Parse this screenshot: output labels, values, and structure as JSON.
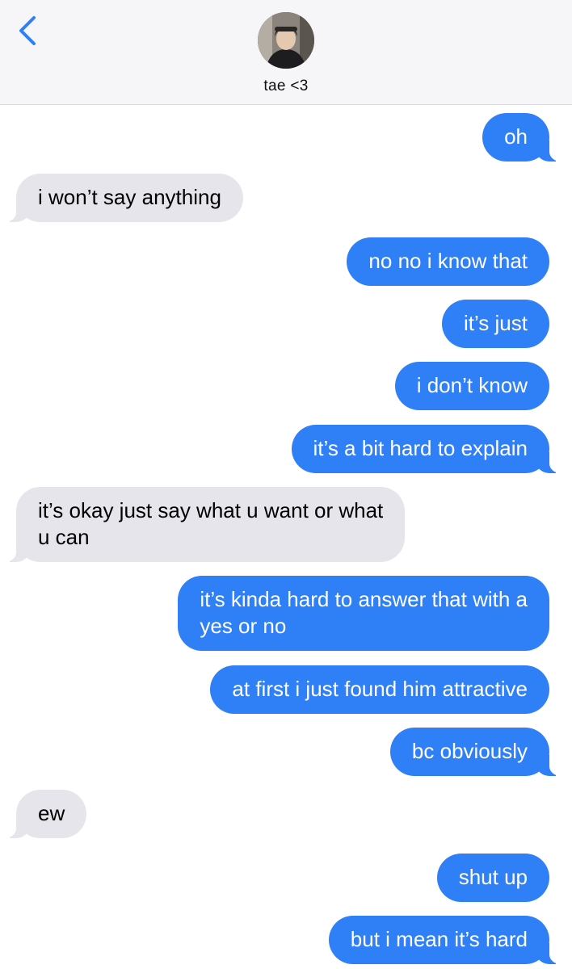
{
  "header": {
    "contact_name": "tae <3",
    "back_icon": "chevron-left-icon",
    "avatar": "contact-photo"
  },
  "colors": {
    "sent_bubble": "#2f7ff6",
    "received_bubble": "#e6e5eb",
    "back_accent": "#2f7ff6"
  },
  "messages": [
    {
      "from": "me",
      "text": "oh"
    },
    {
      "from": "them",
      "text": "i won’t say anything"
    },
    {
      "from": "me",
      "text": "no no i know that"
    },
    {
      "from": "me",
      "text": "it’s just"
    },
    {
      "from": "me",
      "text": "i don’t know"
    },
    {
      "from": "me",
      "text": "it’s a bit hard to explain"
    },
    {
      "from": "them",
      "text": "it’s okay just say what u want or what\nu can"
    },
    {
      "from": "me",
      "text": "it’s kinda hard to answer that with a\nyes or no"
    },
    {
      "from": "me",
      "text": "at first i just found him attractive"
    },
    {
      "from": "me",
      "text": "bc obviously"
    },
    {
      "from": "them",
      "text": "ew"
    },
    {
      "from": "me",
      "text": "shut up"
    },
    {
      "from": "me",
      "text": "but i mean it’s hard"
    }
  ]
}
